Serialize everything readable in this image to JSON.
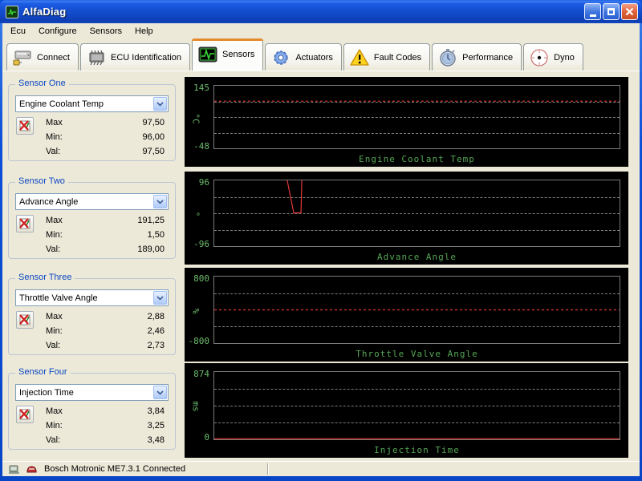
{
  "window": {
    "title": "AlfaDiag"
  },
  "menu": {
    "items": [
      "Ecu",
      "Configure",
      "Sensors",
      "Help"
    ]
  },
  "tabs": [
    {
      "label": "Connect",
      "active": false
    },
    {
      "label": "ECU Identification",
      "active": false
    },
    {
      "label": "Sensors",
      "active": true
    },
    {
      "label": "Actuators",
      "active": false
    },
    {
      "label": "Fault Codes",
      "active": false
    },
    {
      "label": "Performance",
      "active": false
    },
    {
      "label": "Dyno",
      "active": false
    }
  ],
  "labels": {
    "max": "Max",
    "min": "Min:",
    "val": "Val:"
  },
  "sensors": [
    {
      "group": "Sensor One",
      "selected": "Engine Coolant Temp",
      "max": "97,50",
      "min": "96,00",
      "val": "97,50"
    },
    {
      "group": "Sensor Two",
      "selected": "Advance Angle",
      "max": "191,25",
      "min": "1,50",
      "val": "189,00"
    },
    {
      "group": "Sensor Three",
      "selected": "Throttle Valve Angle",
      "max": "2,88",
      "min": "2,46",
      "val": "2,73"
    },
    {
      "group": "Sensor Four",
      "selected": "Injection Time",
      "max": "3,84",
      "min": "3,25",
      "val": "3,48"
    }
  ],
  "charts": [
    {
      "title": "Engine Coolant Temp",
      "unit": "°C",
      "ymax": "145",
      "ymin": "-48",
      "trace_pct": [
        [
          0,
          24.6
        ],
        [
          100,
          24.6
        ]
      ],
      "dash": "3,3"
    },
    {
      "title": "Advance Angle",
      "unit": "°",
      "ymax": "96",
      "ymin": "-96",
      "trace_pct": [
        [
          18,
          0
        ],
        [
          19.6,
          49.4
        ],
        [
          21.4,
          49.4
        ],
        [
          21.6,
          0
        ]
      ],
      "dash": ""
    },
    {
      "title": "Throttle Valve Angle",
      "unit": "%",
      "ymax": "800",
      "ymin": "-800",
      "trace_pct": [
        [
          0,
          50
        ],
        [
          100,
          50
        ]
      ],
      "dash": "3,3"
    },
    {
      "title": "Injection Time",
      "unit": "ms",
      "ymax": "874",
      "ymin": "0",
      "trace_pct": [
        [
          0,
          99.2
        ],
        [
          100,
          99.2
        ]
      ],
      "dash": ""
    }
  ],
  "chart_data": [
    {
      "type": "line",
      "title": "Engine Coolant Temp",
      "ylabel": "°C",
      "ylim": [
        -48,
        145
      ],
      "series": [
        {
          "name": "Engine Coolant Temp",
          "values": [
            97.5,
            97.5
          ]
        }
      ],
      "current": 97.5,
      "min": 96.0,
      "max": 97.5,
      "grid": "dashed 25/50/75%",
      "legend_position": "none"
    },
    {
      "type": "line",
      "title": "Advance Angle",
      "ylabel": "°",
      "ylim": [
        -96,
        96
      ],
      "series": [
        {
          "name": "Advance Angle",
          "values": [
            189.0,
            1.5,
            189.0
          ]
        }
      ],
      "current": 189.0,
      "min": 1.5,
      "max": 191.25,
      "note": "trace clipped above +96; brief dip to ~0 at ~20% of timeline",
      "grid": "dashed 25/50/75%",
      "legend_position": "none"
    },
    {
      "type": "line",
      "title": "Throttle Valve Angle",
      "ylabel": "%",
      "ylim": [
        -800,
        800
      ],
      "series": [
        {
          "name": "Throttle Valve Angle",
          "values": [
            2.73,
            2.73
          ]
        }
      ],
      "current": 2.73,
      "min": 2.46,
      "max": 2.88,
      "grid": "dashed 25/50/75%",
      "legend_position": "none"
    },
    {
      "type": "line",
      "title": "Injection Time",
      "ylabel": "ms",
      "ylim": [
        0,
        874
      ],
      "series": [
        {
          "name": "Injection Time",
          "values": [
            3.48,
            3.48
          ]
        }
      ],
      "current": 3.48,
      "min": 3.25,
      "max": 3.84,
      "grid": "dashed 25/50/75%",
      "legend_position": "none"
    }
  ],
  "status": {
    "text": "Bosch Motronic ME7.3.1 Connected"
  },
  "colors": {
    "accent_orange": "#E68B2C",
    "chart_green": "#55A555",
    "axis_green": "#6CBB6C",
    "trace_red": "#E03838",
    "group_caption_blue": "#0B46C4",
    "panel_bg": "#ECE9D8",
    "chart_bg": "#000000",
    "titlebar_blue": "#1148C6"
  }
}
